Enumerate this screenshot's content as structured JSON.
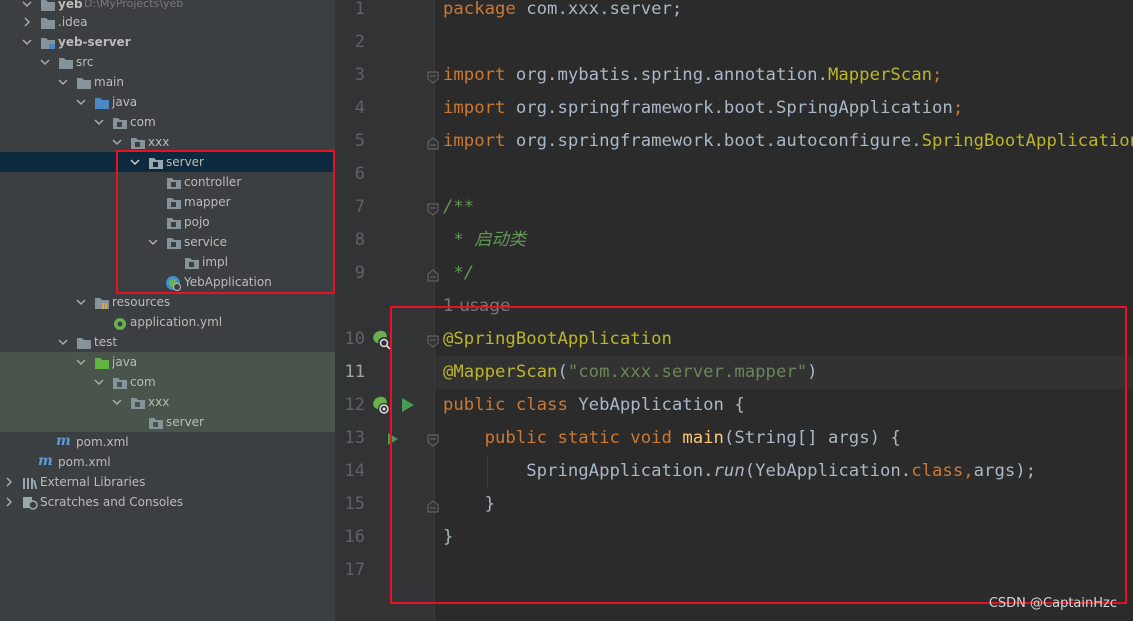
{
  "project_tree": {
    "project_name": "yeb",
    "project_path": "D:\\MyProjects\\yeb",
    "items": [
      {
        "label": "yeb",
        "icon": "folder-icon"
      },
      {
        "label": ".idea",
        "icon": "folder-icon"
      },
      {
        "label": "yeb-server",
        "icon": "module-folder-icon"
      },
      {
        "label": "src",
        "icon": "folder-icon"
      },
      {
        "label": "main",
        "icon": "folder-icon"
      },
      {
        "label": "java",
        "icon": "source-folder-icon"
      },
      {
        "label": "com",
        "icon": "package-icon"
      },
      {
        "label": "xxx",
        "icon": "package-icon"
      },
      {
        "label": "server",
        "icon": "package-icon"
      },
      {
        "label": "controller",
        "icon": "package-icon"
      },
      {
        "label": "mapper",
        "icon": "package-icon"
      },
      {
        "label": "pojo",
        "icon": "package-icon"
      },
      {
        "label": "service",
        "icon": "package-icon"
      },
      {
        "label": "impl",
        "icon": "package-icon"
      },
      {
        "label": "YebApplication",
        "icon": "spring-boot-class-icon"
      },
      {
        "label": "resources",
        "icon": "resources-folder-icon"
      },
      {
        "label": "application.yml",
        "icon": "spring-config-icon"
      },
      {
        "label": "test",
        "icon": "folder-icon"
      },
      {
        "label": "java",
        "icon": "test-source-folder-icon"
      },
      {
        "label": "com",
        "icon": "package-icon"
      },
      {
        "label": "xxx",
        "icon": "package-icon"
      },
      {
        "label": "server",
        "icon": "package-icon"
      },
      {
        "label": "pom.xml",
        "icon": "maven-icon"
      },
      {
        "label": "pom.xml",
        "icon": "maven-icon"
      },
      {
        "label": "External Libraries",
        "icon": "libraries-icon"
      },
      {
        "label": "Scratches and Consoles",
        "icon": "scratches-icon"
      }
    ]
  },
  "editor": {
    "line_numbers": [
      "1",
      "2",
      "3",
      "4",
      "5",
      "6",
      "7",
      "8",
      "9",
      "10",
      "11",
      "12",
      "13",
      "14",
      "15",
      "16",
      "17"
    ],
    "current_line": "11",
    "usage_hint": "1 usage",
    "code": {
      "l1_kw": "package",
      "l1_rest": " com.xxx.server;",
      "l3_kw": "import",
      "l3_pkg": " org.mybatis.spring.annotation.",
      "l3_cls": "MapperScan",
      "l3_semi": ";",
      "l4_kw": "import",
      "l4_pkg": " org.springframework.boot.SpringApplication",
      "l4_semi": ";",
      "l5_kw": "import",
      "l5_pkg": " org.springframework.boot.autoconfigure.",
      "l5_cls": "SpringBootApplication",
      "l7": "/**",
      "l8": " * 启动类",
      "l9": " */",
      "l10": "@SpringBootApplication",
      "l11_ann": "@MapperScan",
      "l11_open": "(",
      "l11_str": "\"com.xxx.server.mapper\"",
      "l11_close": ")",
      "l12_kw": "public class",
      "l12_rest": " YebApplication {",
      "l13_indent": "    ",
      "l13_kw": "public static void",
      "l13_sp": " ",
      "l13_fn": "main",
      "l13_rest": "(String[] args) {",
      "l14_a": "        SpringApplication.",
      "l14_run": "run",
      "l14_b": "(YebApplication.",
      "l14_kw": "class",
      "l14_comma": ",",
      "l14_c": "args);",
      "l15": "    }",
      "l16": "}"
    }
  },
  "watermark": "CSDN @CaptainHzc",
  "colors": {
    "highlight_box": "#e81123",
    "keyword": "#cc7832",
    "annotation": "#bbb529",
    "string": "#6a8759",
    "comment": "#629755",
    "method": "#ffc66d"
  }
}
